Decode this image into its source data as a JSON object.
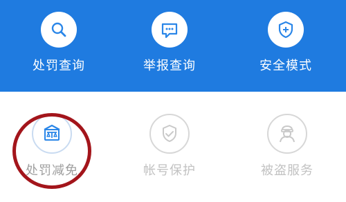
{
  "top_row": {
    "items": [
      {
        "label": "处罚查询",
        "icon": "search-icon"
      },
      {
        "label": "举报查询",
        "icon": "report-message-icon"
      },
      {
        "label": "安全模式",
        "icon": "shield-plus-icon"
      }
    ]
  },
  "bottom_row": {
    "items": [
      {
        "label": "处罚减免",
        "icon": "court-building-icon"
      },
      {
        "label": "帐号保护",
        "icon": "shield-check-icon"
      },
      {
        "label": "被盗服务",
        "icon": "user-service-icon"
      }
    ]
  },
  "colors": {
    "header_blue": "#1f7be0",
    "highlight_red": "#a3151b",
    "icon_blue": "#2a86e8",
    "disabled_gray": "#c2c2c2"
  }
}
